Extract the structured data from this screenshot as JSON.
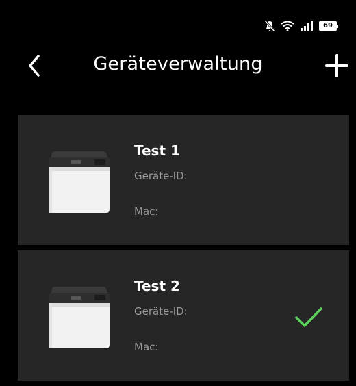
{
  "status_bar": {
    "icons": [
      "mute-icon",
      "wifi-icon",
      "signal-icon",
      "battery-icon"
    ],
    "battery_level": "69"
  },
  "header": {
    "title": "Geräteverwaltung",
    "back_icon": "chevron-left-icon",
    "add_icon": "plus-icon"
  },
  "devices": [
    {
      "name": "Test 1",
      "device_id_label": "Geräte-ID:",
      "mac_label": "Mac:",
      "selected": false
    },
    {
      "name": "Test 2",
      "device_id_label": "Geräte-ID:",
      "mac_label": "Mac:",
      "selected": true
    }
  ],
  "colors": {
    "background": "#000000",
    "card": "#262626",
    "secondary_text": "#9a9a9a",
    "check": "#5cd45c"
  }
}
